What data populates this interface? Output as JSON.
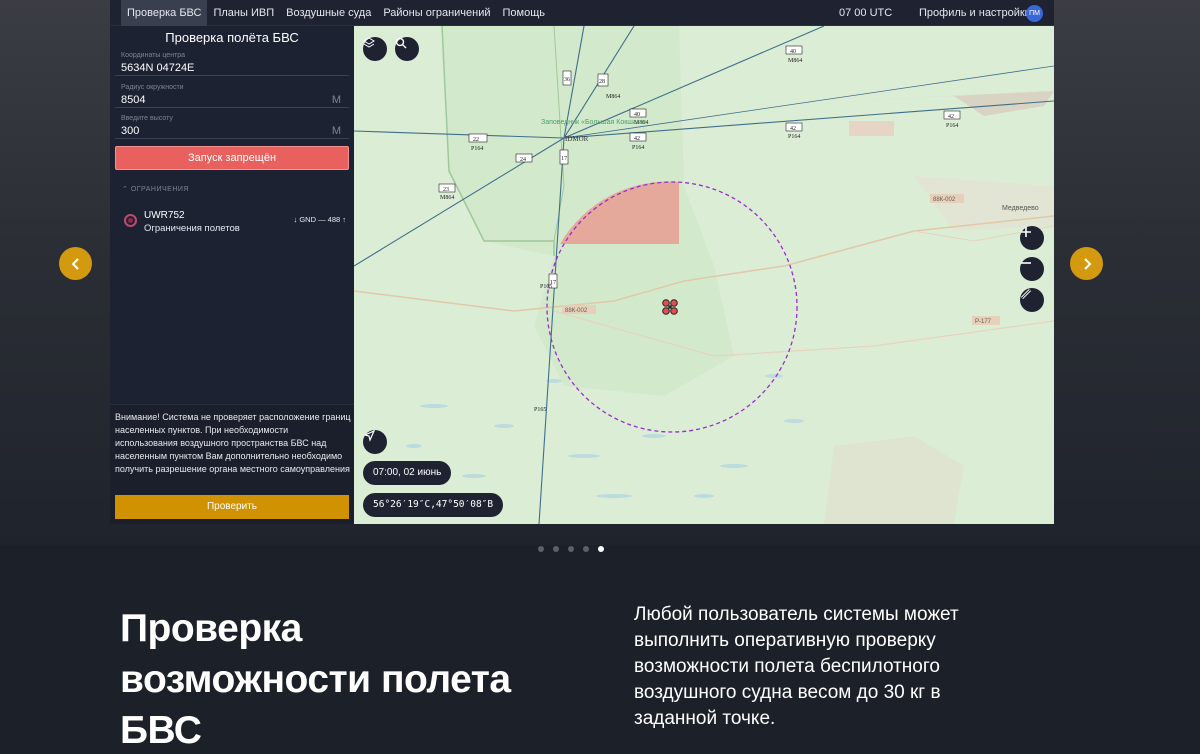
{
  "nav": {
    "items": [
      "Проверка БВС",
      "Планы ИВП",
      "Воздушные суда",
      "Районы ограничений",
      "Помощь"
    ],
    "utc": "07 00 UTC",
    "profile": "Профиль и настройки",
    "avatar": "ПМ"
  },
  "panel": {
    "title": "Проверка полёта БВС",
    "fields": [
      {
        "label": "Координаты центра",
        "value": "5634N 04724E",
        "unit": ""
      },
      {
        "label": "Радиус окружности",
        "value": "8504",
        "unit": "М"
      },
      {
        "label": "Введите высоту",
        "value": "300",
        "unit": "М"
      }
    ],
    "launch_button": "Запуск запрещён",
    "restrictions_header": "ОГРАНИЧЕНИЯ",
    "restrictions": [
      {
        "code": "UWR752",
        "desc": "Ограничения полетов",
        "alt": "↓ GND — 488 ↑"
      }
    ],
    "warning": "Внимание! Система не проверяет расположение границ населенных пунктов. При необходимости использования воздушного пространства БВС над населенным пунктом Вам дополнительно необходимо получить разрешение органа местного самоуправления",
    "check_button": "Проверить"
  },
  "map": {
    "time_pill": "07:00, 02 июнь",
    "coords_pill": "56°26′19″С,47°50′08″В",
    "labels": {
      "reserve": "Заповедник «Большая Кокшага»",
      "point": "IDMOR",
      "road1": "88К-002",
      "road2": "88К-002",
      "road3": "Р-177",
      "town": "Медведево",
      "r1": "22",
      "r1s": "Р164",
      "r2": "24",
      "r3": "23",
      "r3s": "М864",
      "r4": "40",
      "r4s": "М864",
      "r5": "42",
      "r5s": "Р164",
      "r6": "42",
      "r6s": "Р164",
      "r7": "42",
      "r7s": "Р164",
      "r8": "40",
      "r8s": "М864",
      "r9": "36",
      "r10": "17",
      "r11": "28",
      "r11s": "М864",
      "r12": "Р165",
      "r13": "Р165",
      "r14": "17"
    },
    "colors": {
      "circle": "#9a2ccf",
      "zone": "#e8998e",
      "land": "#d9ecd3",
      "route": "#3f6e8a"
    }
  },
  "carousel": {
    "dots": 5,
    "active": 4
  },
  "headline": "Проверка возможности полета БВС",
  "description": "Любой пользователь системы может выполнить оперативную проверку возможности полета беспилотного воздушного судна весом до 30 кг в заданной точке."
}
